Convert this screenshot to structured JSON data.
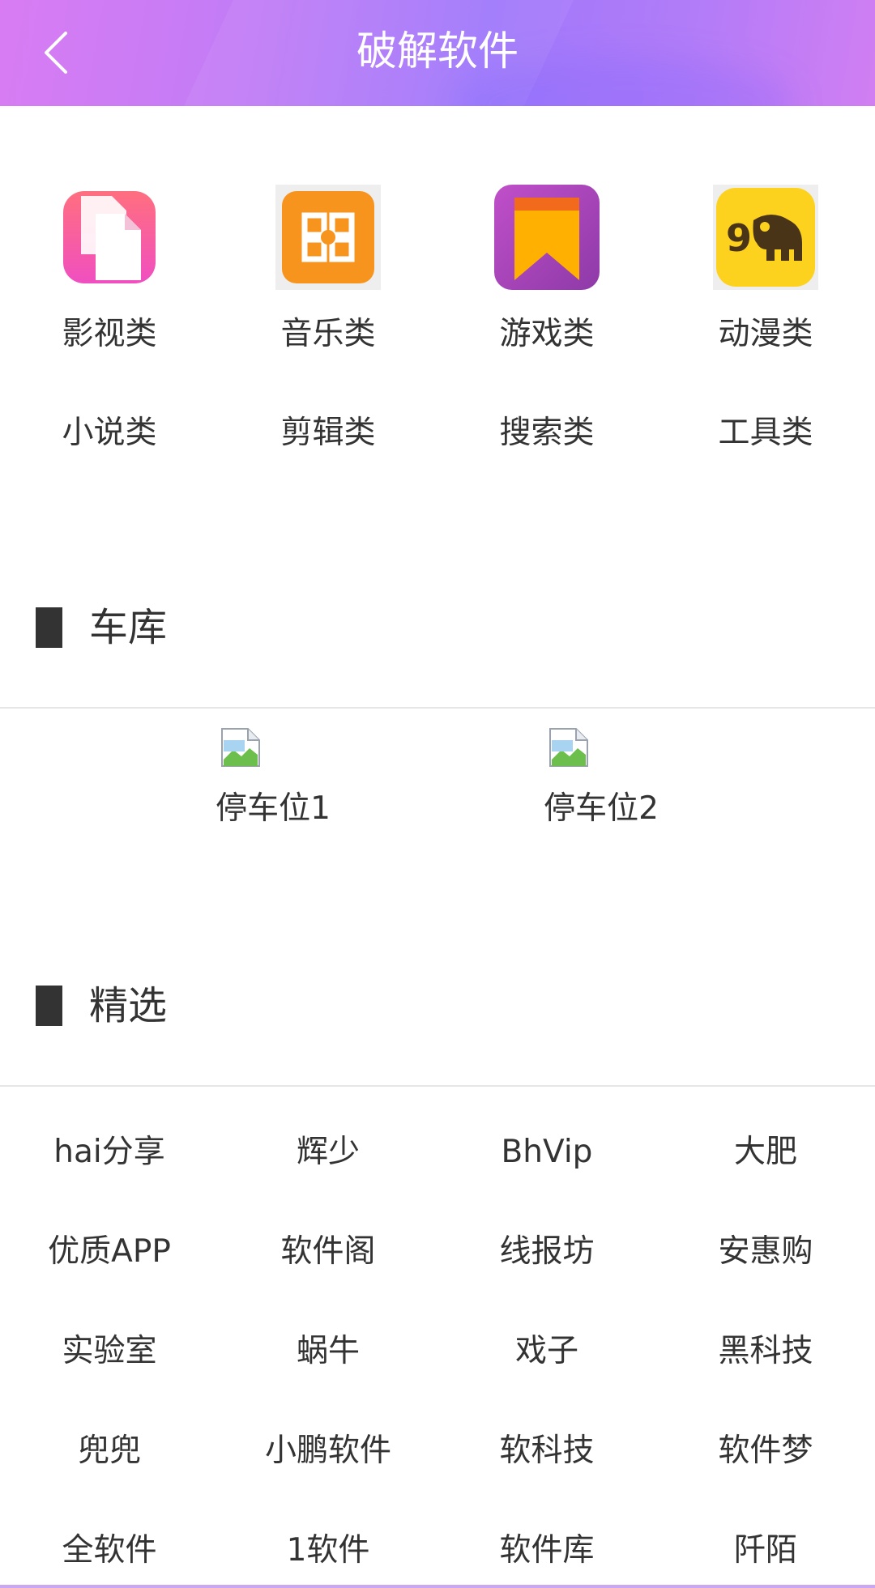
{
  "header": {
    "title": "破解软件",
    "back_icon": "chevron-left-icon"
  },
  "categories": [
    {
      "label": "影视类",
      "icon": "document-copy-icon"
    },
    {
      "label": "音乐类",
      "icon": "office-logo-icon"
    },
    {
      "label": "游戏类",
      "icon": "bookmark-icon"
    },
    {
      "label": "动漫类",
      "icon": "elephant-logo-icon"
    },
    {
      "label": "小说类"
    },
    {
      "label": "剪辑类"
    },
    {
      "label": "搜索类"
    },
    {
      "label": "工具类"
    }
  ],
  "garage": {
    "title": "车库",
    "items": [
      {
        "label": "停车位1",
        "icon": "broken-image-icon"
      },
      {
        "label": "停车位2",
        "icon": "broken-image-icon"
      }
    ]
  },
  "featured": {
    "title": "精选",
    "items": [
      "hai分享",
      "辉少",
      "BhVip",
      "大肥",
      "优质APP",
      "软件阁",
      "线报坊",
      "安惠购",
      "实验室",
      "蜗牛",
      "戏子",
      "黑科技",
      "兜兜",
      "小鹏软件",
      "软科技",
      "软件梦",
      "全软件",
      "1软件",
      "软件库",
      "阡陌"
    ]
  },
  "colors": {
    "header_start": "#d97cf3",
    "header_mid": "#9f78fb",
    "text": "#333333",
    "divider": "#e6e6e6"
  }
}
